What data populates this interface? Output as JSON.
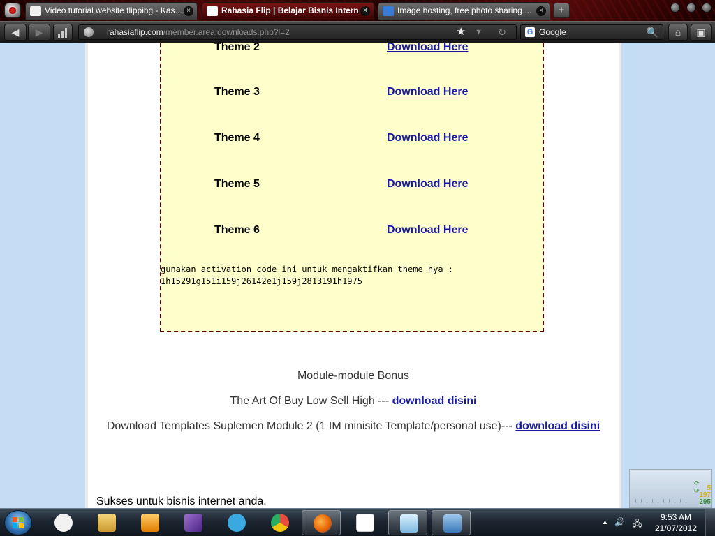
{
  "browser": {
    "tabs": [
      {
        "title": "Video tutorial website flipping - Kas...",
        "active": false,
        "favicon": "kaskus-favicon",
        "color": "#f0f0f0"
      },
      {
        "title": "Rahasia Flip | Belajar Bisnis Intern...",
        "active": true,
        "favicon": "page-favicon",
        "color": "#ffffff"
      },
      {
        "title": "Image hosting, free photo sharing ...",
        "active": false,
        "favicon": "photobucket-favicon",
        "color": "#3a7bd5"
      }
    ],
    "close_glyph": "×",
    "new_tab_glyph": "+",
    "address": {
      "host": "rahasiaflip.com",
      "path": "/member.area.downloads.php?l=2"
    },
    "search": {
      "engine": "Google",
      "engine_badge": "G"
    },
    "nav_glyphs": {
      "back": "◀",
      "forward": "▶",
      "bookmark_star": "★",
      "dropdown": "▼",
      "reload": "↻",
      "search": "🔍",
      "home": "⌂",
      "extra": "▣"
    }
  },
  "page": {
    "themes": [
      {
        "name": "Theme 2",
        "link": "Download Here"
      },
      {
        "name": "Theme 3",
        "link": "Download Here"
      },
      {
        "name": "Theme 4",
        "link": "Download Here"
      },
      {
        "name": "Theme 5",
        "link": "Download Here"
      },
      {
        "name": "Theme 6",
        "link": "Download Here"
      }
    ],
    "activation_text": "gunakan activation code ini untuk mengaktifkan theme nya :",
    "activation_code": "1h15291g151i159j26142e1j159j2813191h1975",
    "bonus_heading": "Module-module Bonus",
    "bonus_lines": [
      {
        "text": "The Art Of Buy Low Sell High --- ",
        "link": "download disini"
      },
      {
        "text": "Download Templates Suplemen Module 2 (1 IM minisite Template/personal use)--- ",
        "link": "download disini"
      }
    ],
    "closing": "Sukses untuk bisnis internet anda."
  },
  "gadget": {
    "values": [
      {
        "value": "5",
        "color": "#d4b000"
      },
      {
        "value": "197",
        "color": "#d4b000"
      },
      {
        "value": "295",
        "color": "#2a8a2a"
      }
    ]
  },
  "taskbar": {
    "pinned": [
      {
        "name": "activity-monitor",
        "color": "#f2f2f2",
        "active": false
      },
      {
        "name": "explorer",
        "color": "#e8c25a",
        "active": false
      },
      {
        "name": "media-player",
        "color": "#f0a040",
        "active": false
      },
      {
        "name": "visual-studio",
        "color": "#7b4fa8",
        "active": false
      },
      {
        "name": "twitter",
        "color": "#39a9e0",
        "active": false
      },
      {
        "name": "chrome",
        "color": "#e74c3c",
        "active": false
      },
      {
        "name": "firefox",
        "color": "#e66000",
        "active": true
      },
      {
        "name": "smartfren",
        "color": "#ffffff",
        "active": false
      },
      {
        "name": "notepad",
        "color": "#9ed1ef",
        "active": false
      },
      {
        "name": "image-viewer",
        "color": "#5b9bd5",
        "active": false
      }
    ],
    "tray_glyphs": {
      "up": "▲",
      "volume": "🔊",
      "network": "🖧"
    },
    "time": "9:53 AM",
    "date": "21/07/2012"
  }
}
